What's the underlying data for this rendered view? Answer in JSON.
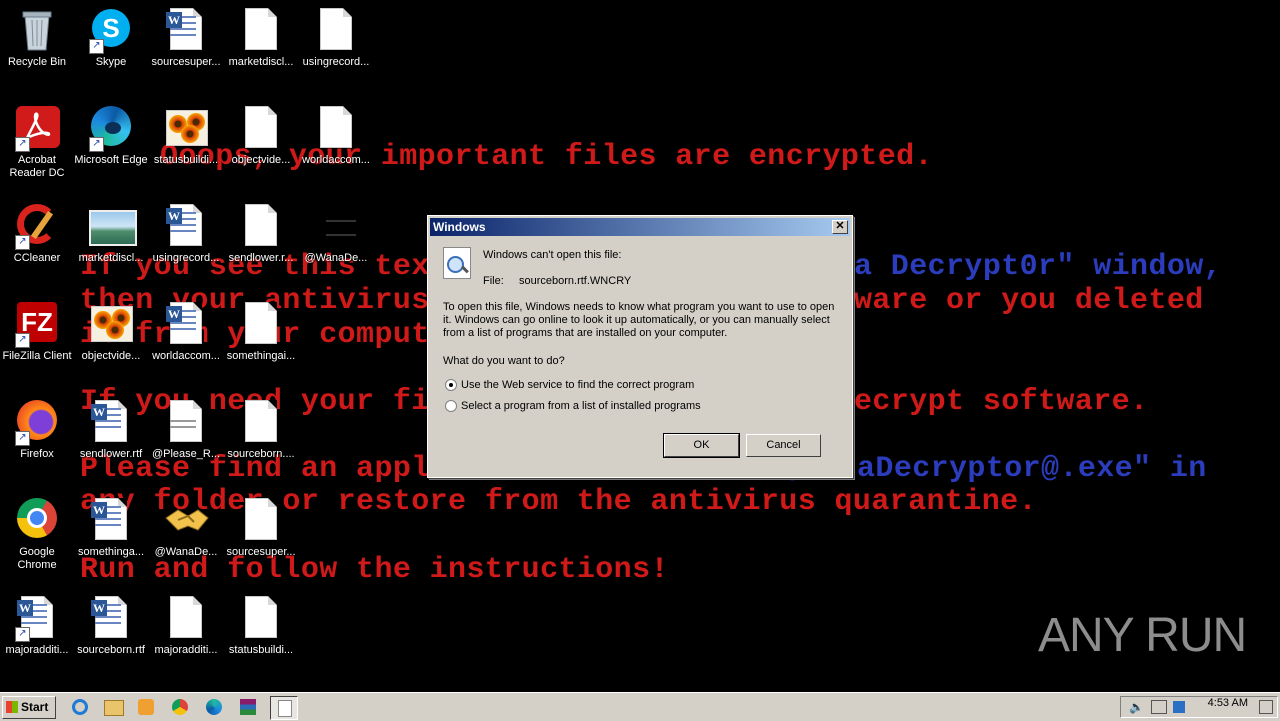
{
  "wallpaper": {
    "line1": "Ooops, your important files are encrypted.",
    "line2a": "If you see this text",
    "line2b": "a Decrypt0r\" window,",
    "line3a": "then your antivirus",
    "line3b": "ware or you deleted",
    "line4": "it from your computer.",
    "line5a": "If you need your fil",
    "line5b": "ecrypt software.",
    "line6a": "Please find an application file named",
    "line6b": "\"@WanaDecryptor@.exe\" in",
    "line7": "any folder or restore from the antivirus quarantine.",
    "line8": "Run and follow the instructions!"
  },
  "desktop_icons": {
    "recycle_bin": "Recycle Bin",
    "skype": "Skype",
    "sourcesuper1": "sourcesuper...",
    "marketdiscl1": "marketdiscl...",
    "usingrecord1": "usingrecord...",
    "acrobat": "Acrobat Reader DC",
    "edge": "Microsoft Edge",
    "statusbuild1": "statusbuildi...",
    "objectvide1": "objectvide...",
    "worldaccom1": "worldaccom...",
    "ccleaner": "CCleaner",
    "marketdiscl2": "marketdiscl...",
    "usingrecord2": "usingrecord...",
    "sendlower1": "sendlower.r...",
    "wanade1": "@WanaDe...",
    "filezilla": "FileZilla Client",
    "objectvide2": "objectvide...",
    "worldaccom2": "worldaccom...",
    "somethingai": "somethingai...",
    "firefox": "Firefox",
    "sendlower2": "sendlower.rtf",
    "please_r": "@Please_R...",
    "sourceborn1": "sourceborn....",
    "chrome": "Google Chrome",
    "somethinga": "somethinga...",
    "wanade2": "@WanaDe...",
    "sourcesuper2": "sourcesuper...",
    "majoraddi1": "majoradditi...",
    "sourceborn2": "sourceborn.rtf",
    "majoraddi2": "majoradditi...",
    "statusbuild2": "statusbuildi..."
  },
  "dialog": {
    "title": "Windows",
    "close_glyph": "✕",
    "cant_open": "Windows can't open this file:",
    "file_label": "File:",
    "file_name": "sourceborn.rtf.WNCRY",
    "description": "To open this file, Windows needs to know what program you want to use to open it. Windows can go online to look it up automatically, or you can manually select from a list of programs that are installed on your computer.",
    "question": "What do you want to do?",
    "option_web": "Use the Web service to find the correct program",
    "option_list": "Select a program from a list of installed programs",
    "selected_option": "option_web",
    "ok_label": "OK",
    "cancel_label": "Cancel"
  },
  "taskbar": {
    "start_label": "Start",
    "clock": "4:53 AM"
  },
  "watermark": "ANY RUN"
}
